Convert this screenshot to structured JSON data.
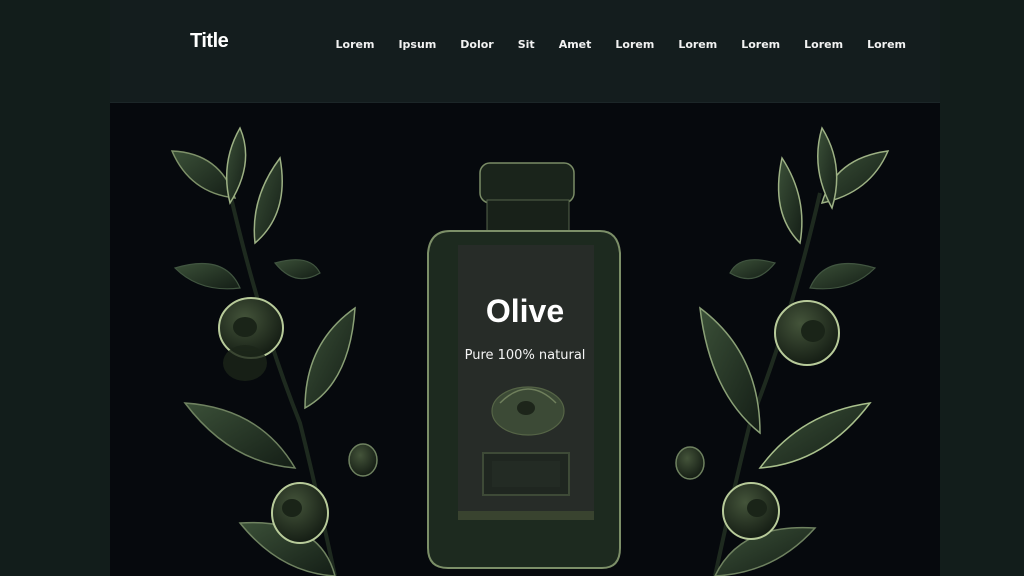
{
  "header": {
    "logo": "Title",
    "nav": [
      {
        "label": "Lorem"
      },
      {
        "label": "Ipsum"
      },
      {
        "label": "Dolor"
      },
      {
        "label": "Sit"
      },
      {
        "label": "Amet"
      },
      {
        "label": "Lorem"
      },
      {
        "label": "Lorem"
      },
      {
        "label": "Lorem"
      },
      {
        "label": "Lorem"
      },
      {
        "label": "Lorem"
      }
    ]
  },
  "hero": {
    "product_title": "Olive",
    "product_subtitle": "Pure 100% natural"
  },
  "colors": {
    "background": "#06090d",
    "header": "#141d1e",
    "leaf": "#2f4231",
    "leaf_highlight": "#a9c08c",
    "bottle": "#1d2a1f",
    "label": "#272c28"
  }
}
